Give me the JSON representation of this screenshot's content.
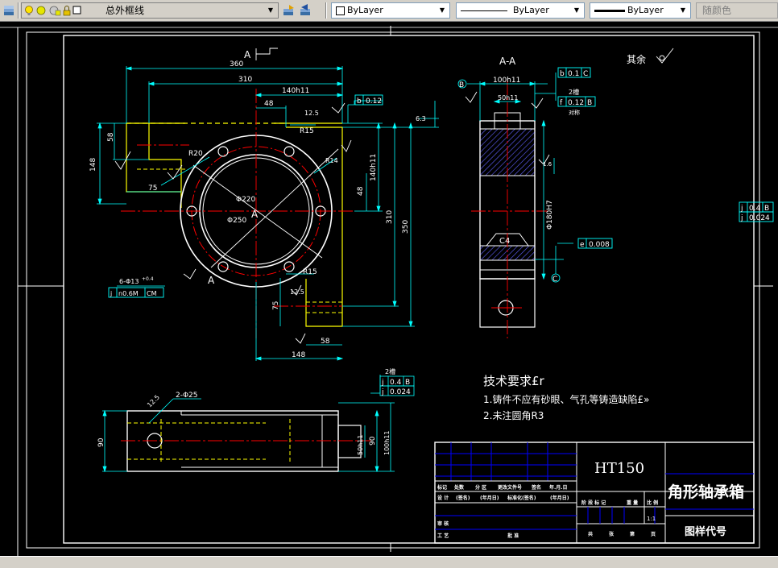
{
  "toolbar": {
    "layer_name": "总外框线",
    "color_value": "ByLayer",
    "linetype_value": "ByLayer",
    "lineweight_value": "ByLayer",
    "plotstyle_value": "随颜色"
  },
  "drawing": {
    "section_marker": "A",
    "section_title": "A-A",
    "roughness_note": "其余",
    "center_label": "A",
    "dims": {
      "d360": "360",
      "d310": "310",
      "d140h11": "140h11",
      "d48": "48",
      "d58": "58",
      "d148": "148",
      "d75": "75",
      "d12_5": "12.5",
      "dR15": "R15",
      "dR20": "R20",
      "dR14": "R14",
      "dphi220": "Φ220",
      "dphi250": "Φ250",
      "d140h11v": "140h11",
      "d48v": "48",
      "d310v": "310",
      "d350v": "350",
      "d6_3": "6.3",
      "d75b": "75",
      "d58b": "58",
      "d148b": "148",
      "dR15b": "R15",
      "d12_5b": "12.5",
      "d100h11": "100h11",
      "d50h11": "50h11",
      "d2cao": "2槽",
      "dduicheng": "对称",
      "dphi180": "Φ180H7",
      "d1_6": "1.6",
      "dC4": "C4",
      "d90": "90",
      "d50h11b": "50h11",
      "d100h11b": "100h11",
      "d2phi25": "2-Φ25",
      "d12_5c": "12.5",
      "d90b": "90",
      "holes": "6-Φ13",
      "holes_fit": "+0.4"
    },
    "fcf": {
      "top_ref": "b",
      "top_val": "0.12",
      "a_sym": "b",
      "a_val": "0.1",
      "a_datum": "C",
      "b_sym": "f",
      "b_val": "0.12",
      "b_datum": "B",
      "e_sym": "e",
      "e_val": "0.008",
      "right1_sym": "j",
      "right1_val": "0.4",
      "right1_datum": "B",
      "right2_sym": "j",
      "right2_val": "0.024",
      "holes_sym": "j",
      "holes_val": "n0.6M",
      "holes_datum": "CM",
      "bot1_sym": "j",
      "bot1_val": "0.4",
      "bot1_datum": "B",
      "bot2_sym": "j",
      "bot2_val": "0.024",
      "bot_count": "2槽"
    },
    "datum_b": "B",
    "datum_c": "C",
    "tech_req_title": "技术要求£r",
    "tech_req_1": "1.铸件不应有砂眼、气孔等铸造缺陷£»",
    "tech_req_2": "2.未注圆角R3"
  },
  "title_block": {
    "material": "HT150",
    "part_name": "角形轴承箱",
    "drawing_code": "图样代号",
    "scale": "1:1",
    "row_header": [
      "标记",
      "处数",
      "分 区",
      "更改文件号",
      "签名",
      "年.月.日"
    ],
    "row_design": [
      "设 计",
      "(签名)",
      "(年月日)",
      "标准化(签名)",
      "(年月日)"
    ],
    "row_check": [
      "审 核"
    ],
    "row_process": [
      "工 艺",
      "批 准"
    ],
    "stage_labels": [
      "阶 段 标 记",
      "重 量",
      "比 例"
    ],
    "sheet_labels": [
      "共",
      "张",
      "第",
      "页"
    ]
  }
}
